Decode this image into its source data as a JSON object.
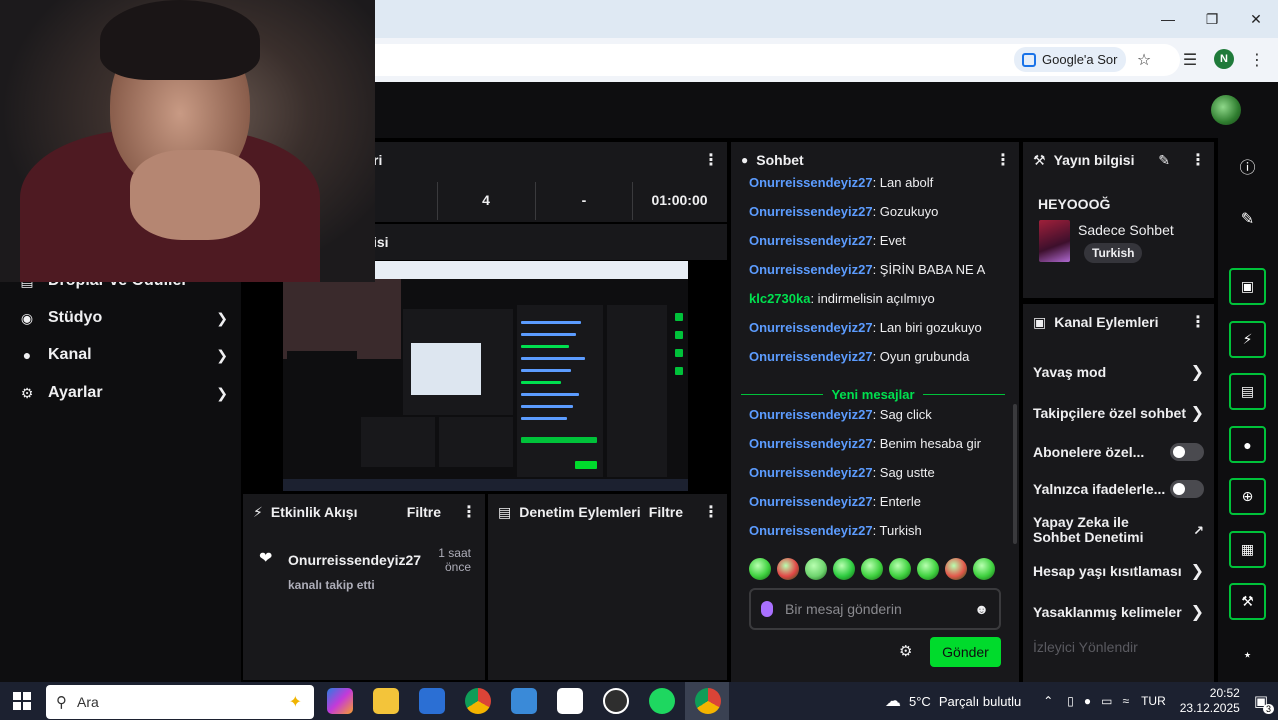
{
  "browser": {
    "google_ask_label": "Google'a Sor",
    "profile_initial": "N"
  },
  "left_nav": {
    "items": [
      {
        "label": "Droplar ve Ödüller",
        "icon": "gift-icon"
      },
      {
        "label": "Stüdyo",
        "icon": "camera-icon"
      },
      {
        "label": "Kanal",
        "icon": "person-icon"
      },
      {
        "label": "Ayarlar",
        "icon": "gear-icon"
      }
    ]
  },
  "stats": {
    "title": "ri",
    "values": [
      "4",
      "-",
      "01:00:00"
    ]
  },
  "preview": {
    "title": "isi"
  },
  "activity": {
    "title": "Etkinlik Akışı",
    "filter_label": "Filtre",
    "event": {
      "user": "Onurreissendeyiz27",
      "action": "kanalı takip etti",
      "time": "1 saat\nönce"
    }
  },
  "modlog": {
    "title": "Denetim Eylemleri",
    "filter_label": "Filtre"
  },
  "chat": {
    "title": "Sohbet",
    "messages_old": [
      {
        "user": "Onurreissendeyiz27",
        "text": ": Lan abolf",
        "color": "#5c9cff"
      },
      {
        "user": "Onurreissendeyiz27",
        "text": ": Gozukuyo",
        "color": "#5c9cff"
      },
      {
        "user": "Onurreissendeyiz27",
        "text": ": Evet",
        "color": "#5c9cff"
      },
      {
        "user": "Onurreissendeyiz27",
        "text": ": ŞİRİN BABA NE A",
        "color": "#5c9cff"
      },
      {
        "user": "klc2730ka",
        "text": ": indirmelisin açılmıyo",
        "color": "#00e04f"
      },
      {
        "user": "Onurreissendeyiz27",
        "text": ": Lan biri gozukuyo",
        "color": "#5c9cff"
      },
      {
        "user": "Onurreissendeyiz27",
        "text": ": Oyun grubunda",
        "color": "#5c9cff"
      }
    ],
    "new_messages_label": "Yeni mesajlar",
    "messages_new": [
      {
        "user": "Onurreissendeyiz27",
        "text": ": Sag click",
        "color": "#5c9cff"
      },
      {
        "user": "Onurreissendeyiz27",
        "text": ": Benim hesaba gir",
        "color": "#5c9cff"
      },
      {
        "user": "Onurreissendeyiz27",
        "text": ": Sag ustte",
        "color": "#5c9cff"
      },
      {
        "user": "Onurreissendeyiz27",
        "text": ": Enterle",
        "color": "#5c9cff"
      },
      {
        "user": "Onurreissendeyiz27",
        "text": ": Turkish",
        "color": "#5c9cff"
      }
    ],
    "input_placeholder": "Bir mesaj gönderin",
    "send_label": "Gönder"
  },
  "stream_info": {
    "title": "Yayın bilgisi",
    "stream_title": "HEYOOOĞ",
    "category": "Sadece Sohbet",
    "tag": "Turkish"
  },
  "channel_actions": {
    "title": "Kanal Eylemleri",
    "items": [
      {
        "label": "Yavaş mod",
        "control": "chevron"
      },
      {
        "label": "Takipçilere özel sohbet",
        "control": "chevron"
      },
      {
        "label": "Abonelere özel...",
        "control": "toggle"
      },
      {
        "label": "Yalnızca ifadelerle...",
        "control": "toggle"
      },
      {
        "label": "Yapay Zeka ile Sohbet Denetimi",
        "control": "external"
      },
      {
        "label": "Hesap yaşı kısıtlaması",
        "control": "chevron"
      },
      {
        "label": "Yasaklanmış kelimeler",
        "control": "chevron"
      },
      {
        "label": "İzleyici Yönlendir",
        "control": "none"
      }
    ]
  },
  "taskbar": {
    "search_label": "Ara",
    "weather_temp": "5°C",
    "weather_text": "Parçalı bulutlu",
    "language": "TUR",
    "time": "20:52",
    "date": "23.12.2025",
    "notification_count": "3"
  },
  "colors": {
    "accent_green": "#00db2c",
    "username_blue": "#5c9cff",
    "username_green": "#00e04f",
    "panel": "#18181b",
    "background": "#0e0e10"
  }
}
